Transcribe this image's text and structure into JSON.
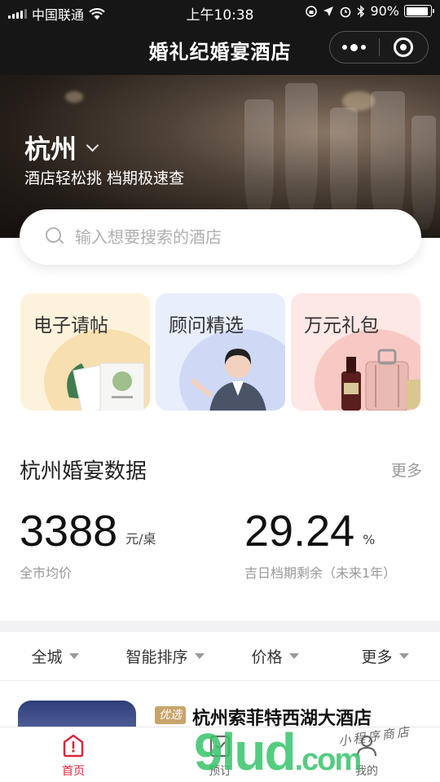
{
  "status_bar": {
    "carrier": "中国联通",
    "time": "上午10:38",
    "battery_text": "90%",
    "battery_level": 0.9
  },
  "navbar": {
    "title": "婚礼纪婚宴酒店"
  },
  "hero": {
    "city": "杭州",
    "tagline": "酒店轻松挑  档期极速查"
  },
  "search": {
    "placeholder": "输入想要搜索的酒店"
  },
  "cards": [
    {
      "label": "电子请帖"
    },
    {
      "label": "顾问精选"
    },
    {
      "label": "万元礼包"
    }
  ],
  "stats_section": {
    "title": "杭州婚宴数据",
    "more": "更多",
    "stats": [
      {
        "value": "3388",
        "unit": "元/桌",
        "caption": "全市均价"
      },
      {
        "value": "29.24",
        "unit": "%",
        "caption": "吉日档期剩余（未来1年）"
      }
    ]
  },
  "filters": [
    "全城",
    "智能排序",
    "价格",
    "更多"
  ],
  "hotel_list": [
    {
      "badge": "优选",
      "name": "杭州索菲特西湖大酒店"
    }
  ],
  "tabbar": [
    {
      "label": "首页",
      "icon": "home-icon",
      "active": true
    },
    {
      "label": "预订",
      "icon": "booking-icon",
      "active": false
    },
    {
      "label": "我的",
      "icon": "profile-icon",
      "active": false
    }
  ],
  "watermark": {
    "brand": "9lud",
    "suffix": ".com",
    "sub": "小程序商店"
  },
  "colors": {
    "accent": "#d9253a",
    "badge": "#c9a46b",
    "dark_bar": "#161616"
  }
}
